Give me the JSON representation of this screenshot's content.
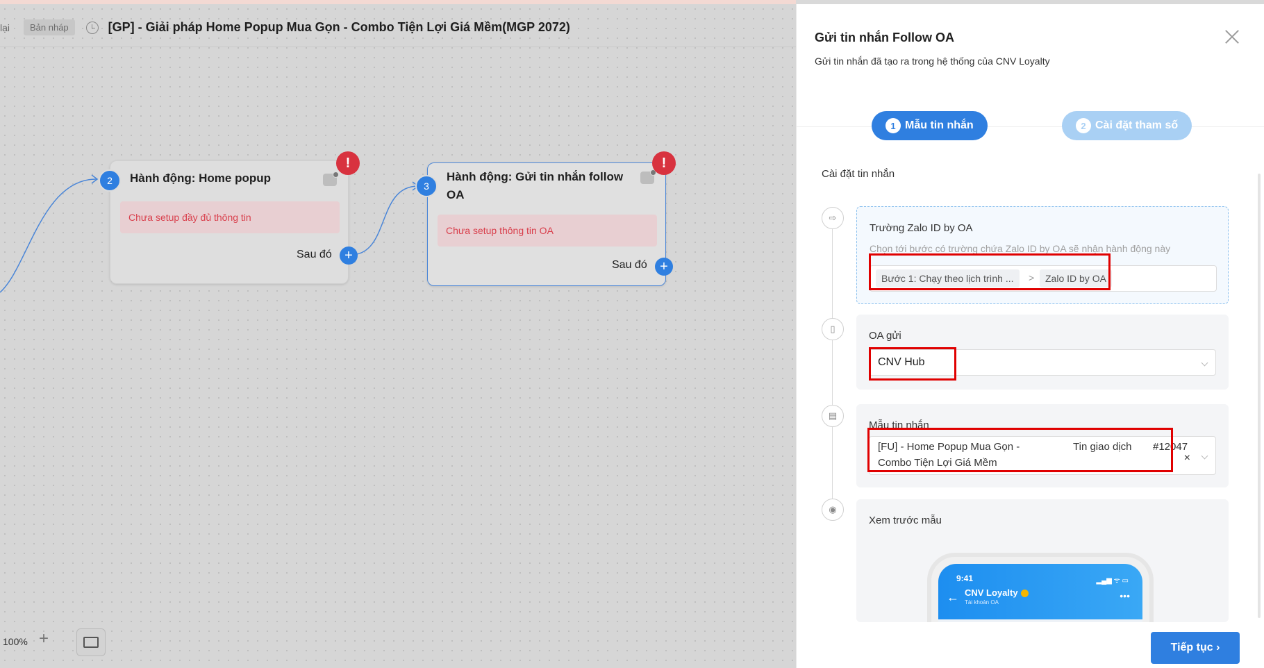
{
  "header": {
    "back_label": "lại",
    "draft_badge": "Bản nháp",
    "workflow_title": "[GP] - Giải pháp Home Popup Mua Gọn - Combo Tiện Lợi Giá Mềm(MGP 2072)"
  },
  "nodes": [
    {
      "step": "2",
      "title_line1": "Hành động: Home popup",
      "title_line2": "",
      "warning": "Chưa setup đầy đủ thông tin",
      "next_label": "Sau đó",
      "error": "!",
      "add": "+"
    },
    {
      "step": "3",
      "title_line1": "Hành động: Gửi tin nhắn follow",
      "title_line2": "OA",
      "warning": "Chưa setup thông tin OA",
      "next_label": "Sau đó",
      "error": "!",
      "add": "+"
    }
  ],
  "zoom": {
    "level": "100%",
    "plus": "+"
  },
  "panel": {
    "title": "Gửi tin nhắn Follow OA",
    "subtitle": "Gửi tin nhắn đã tạo ra trong hệ thống của CNV Loyalty",
    "steps": [
      {
        "num": "1",
        "label": "Mẫu tin nhắn",
        "active": true
      },
      {
        "num": "2",
        "label": "Cài đặt tham số",
        "active": false
      }
    ],
    "section_label": "Cài đặt tin nhắn",
    "zalo_field": {
      "label": "Trường Zalo ID by OA",
      "hint": "Chọn tới bước có trường chứa Zalo ID by OA sẽ nhận hành động này",
      "crumb_step": "Bước 1: Chạy theo lịch trình ...",
      "crumb_sep": ">",
      "crumb_field": "Zalo ID by OA"
    },
    "oa_field": {
      "label": "OA gửi",
      "value": "CNV Hub"
    },
    "template_field": {
      "label": "Mẫu tin nhắn",
      "name_line1": "[FU] - Home Popup Mua Gọn -",
      "name_line2": "Combo Tiện Lợi Giá Mềm",
      "type": "Tin giao dịch",
      "id": "#12047",
      "clear": "×"
    },
    "preview": {
      "label": "Xem trước mẫu",
      "time": "9:41",
      "signal": "▂▄▆ ᯤ ▭",
      "oa_name": "CNV Loyalty",
      "oa_sub": "Tài khoản OA",
      "more": "•••",
      "back": "←"
    },
    "next_button": "Tiếp tục ›"
  },
  "colors": {
    "accent": "#2f7fe0",
    "error": "#d8323f",
    "highlight": "#e00000"
  }
}
